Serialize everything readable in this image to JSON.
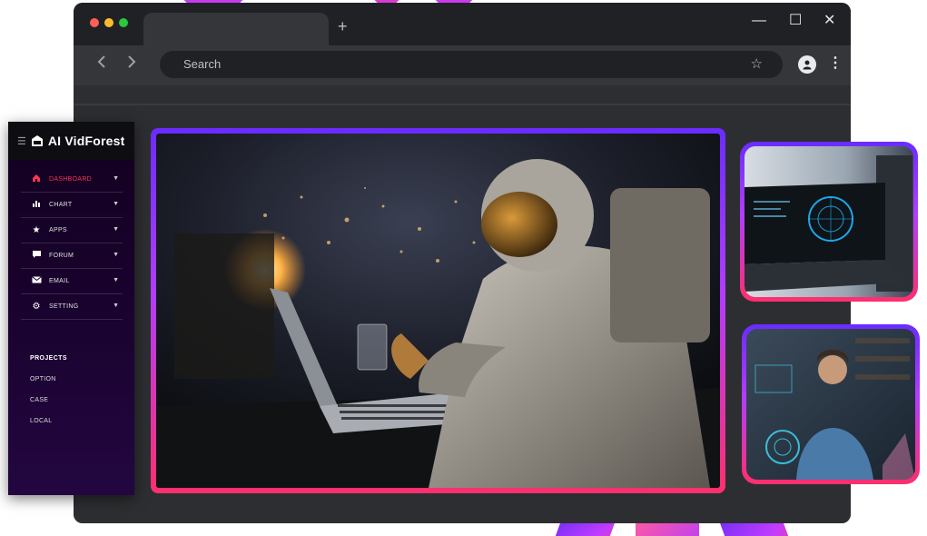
{
  "browser": {
    "tab_title": "",
    "new_tab_label": "+",
    "search_placeholder": "Search",
    "window_controls": {
      "minimize": "—",
      "maximize": "☐",
      "close": "✕"
    },
    "traffic_colors": [
      "#ff5f57",
      "#febc2e",
      "#28c840"
    ],
    "icons": {
      "back": "chevron-left-icon",
      "forward": "chevron-right-icon",
      "bookmark": "star-icon",
      "profile": "user-icon",
      "menu": "kebab-icon"
    }
  },
  "sidebar": {
    "brand": "AI VidForest",
    "items": [
      {
        "label": "DASHBOARD",
        "icon": "home-icon",
        "active": true
      },
      {
        "label": "CHART",
        "icon": "bar-chart-icon",
        "active": false
      },
      {
        "label": "APPS",
        "icon": "star-icon",
        "active": false
      },
      {
        "label": "FORUM",
        "icon": "chat-icon",
        "active": false
      },
      {
        "label": "EMAIL",
        "icon": "mail-icon",
        "active": false
      },
      {
        "label": "SETTING",
        "icon": "gear-icon",
        "active": false
      }
    ],
    "section_title": "PROJECTS",
    "links": [
      "OPTION",
      "CASE",
      "LOCAL"
    ]
  },
  "colors": {
    "accent_red": "#ff3553",
    "frame_gradient": [
      "#6a2cff",
      "#b23cff",
      "#ff2f6d"
    ]
  },
  "media": {
    "main": "astronaut-laptop-image",
    "side_top": "laptop-brain-hologram-image",
    "side_bottom": "developer-hologram-image"
  }
}
